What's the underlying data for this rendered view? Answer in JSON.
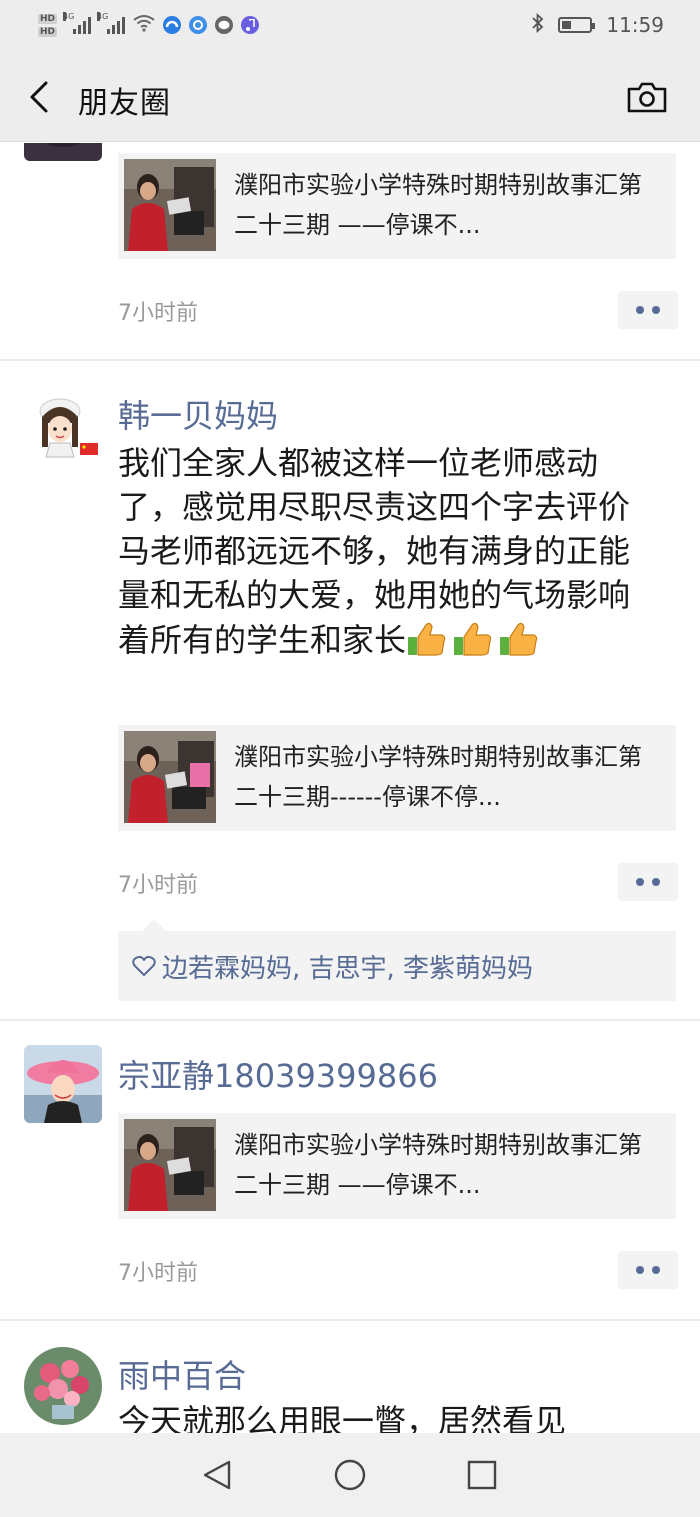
{
  "status_bar": {
    "time": "11:59",
    "hd_labels": [
      "HD",
      "HD"
    ],
    "signal_labels": [
      "4G",
      "4G"
    ],
    "battery_level": 0.35
  },
  "nav": {
    "title": "朋友圈"
  },
  "posts": [
    {
      "link_title": "濮阳市实验小学特殊时期特别故事汇第二十三期 ——停课不...",
      "time": "7小时前"
    },
    {
      "author": "韩一贝妈妈",
      "text": "我们全家人都被这样一位老师感动了，感觉用尽职尽责这四个字去评价马老师都远远不够，她有满身的正能量和无私的大爱，她用她的气场影响着所有的学生和家长",
      "link_title": "濮阳市实验小学特殊时期特别故事汇第二十三期------停课不停...",
      "time": "7小时前",
      "likes": "边若霖妈妈, 吉思宇, 李紫萌妈妈"
    },
    {
      "author": "宗亚静18039399866",
      "link_title": "濮阳市实验小学特殊时期特别故事汇第二十三期 ——停课不...",
      "time": "7小时前"
    },
    {
      "author": "雨中百合",
      "text": "今天就那么用眼一瞥，居然看见"
    }
  ],
  "colors": {
    "name_blue": "#576b95",
    "bar_gray": "#ededed",
    "card_gray": "#f3f3f3"
  }
}
